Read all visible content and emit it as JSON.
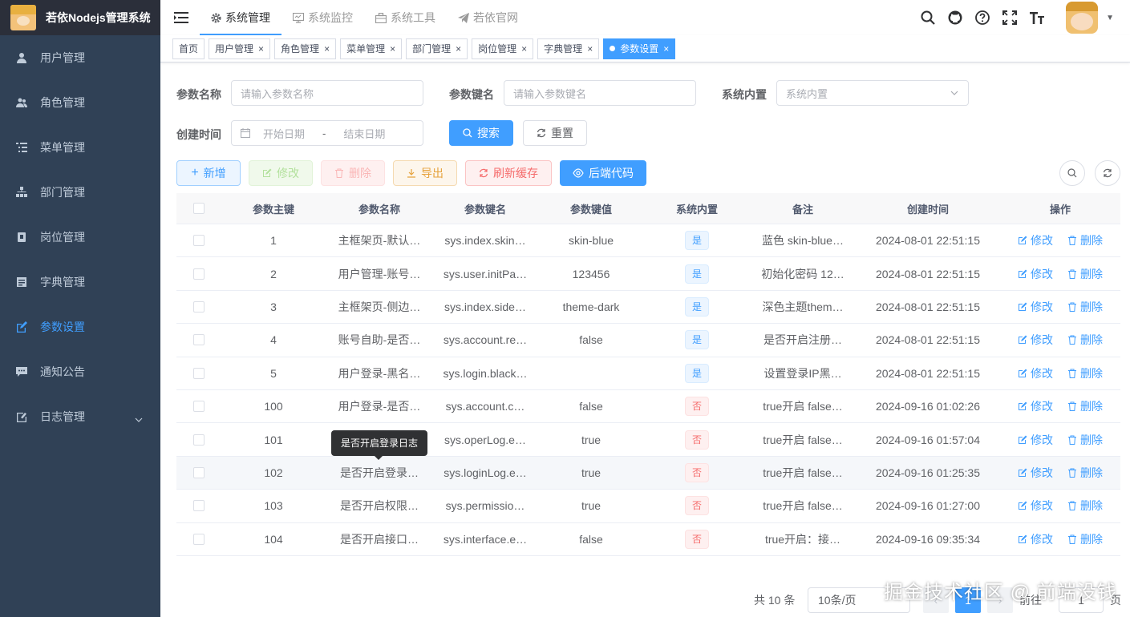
{
  "app": {
    "title": "若依Nodejs管理系统"
  },
  "sidebar": {
    "items": [
      {
        "label": "用户管理"
      },
      {
        "label": "角色管理"
      },
      {
        "label": "菜单管理"
      },
      {
        "label": "部门管理"
      },
      {
        "label": "岗位管理"
      },
      {
        "label": "字典管理"
      },
      {
        "label": "参数设置",
        "active": true
      },
      {
        "label": "通知公告"
      },
      {
        "label": "日志管理"
      }
    ]
  },
  "topnav": {
    "items": [
      {
        "label": "系统管理"
      },
      {
        "label": "系统监控"
      },
      {
        "label": "系统工具"
      },
      {
        "label": "若依官网"
      }
    ]
  },
  "tags": [
    "首页",
    "用户管理",
    "角色管理",
    "菜单管理",
    "部门管理",
    "岗位管理",
    "字典管理",
    "参数设置"
  ],
  "form": {
    "name_label": "参数名称",
    "name_placeholder": "请输入参数名称",
    "key_label": "参数键名",
    "key_placeholder": "请输入参数键名",
    "builtin_label": "系统内置",
    "builtin_placeholder": "系统内置",
    "time_label": "创建时间",
    "start_placeholder": "开始日期",
    "range_sep": "-",
    "end_placeholder": "结束日期",
    "search_label": "搜索",
    "reset_label": "重置"
  },
  "toolbar": {
    "add": "新增",
    "edit": "修改",
    "delete": "删除",
    "export": "导出",
    "refresh_cache": "刷新缓存",
    "backend_code": "后端代码"
  },
  "table": {
    "headers": [
      "参数主键",
      "参数名称",
      "参数键名",
      "参数键值",
      "系统内置",
      "备注",
      "创建时间",
      "操作"
    ],
    "rows": [
      {
        "id": "1",
        "name": "主框架页-默认…",
        "key": "sys.index.skin…",
        "value": "skin-blue",
        "builtin": "是",
        "remark": "蓝色 skin-blue…",
        "time": "2024-08-01 22:51:15"
      },
      {
        "id": "2",
        "name": "用户管理-账号…",
        "key": "sys.user.initPa…",
        "value": "123456",
        "builtin": "是",
        "remark": "初始化密码 12…",
        "time": "2024-08-01 22:51:15"
      },
      {
        "id": "3",
        "name": "主框架页-侧边…",
        "key": "sys.index.side…",
        "value": "theme-dark",
        "builtin": "是",
        "remark": "深色主题them…",
        "time": "2024-08-01 22:51:15"
      },
      {
        "id": "4",
        "name": "账号自助-是否…",
        "key": "sys.account.re…",
        "value": "false",
        "builtin": "是",
        "remark": "是否开启注册…",
        "time": "2024-08-01 22:51:15"
      },
      {
        "id": "5",
        "name": "用户登录-黑名…",
        "key": "sys.login.black…",
        "value": "",
        "builtin": "是",
        "remark": "设置登录IP黑…",
        "time": "2024-08-01 22:51:15"
      },
      {
        "id": "100",
        "name": "用户登录-是否…",
        "key": "sys.account.c…",
        "value": "false",
        "builtin": "否",
        "remark": "true开启 false…",
        "time": "2024-09-16 01:02:26"
      },
      {
        "id": "101",
        "name": "",
        "key": "sys.operLog.e…",
        "value": "true",
        "builtin": "否",
        "remark": "true开启 false…",
        "time": "2024-09-16 01:57:04"
      },
      {
        "id": "102",
        "name": "是否开启登录…",
        "key": "sys.loginLog.e…",
        "value": "true",
        "builtin": "否",
        "remark": "true开启 false…",
        "time": "2024-09-16 01:25:35"
      },
      {
        "id": "103",
        "name": "是否开启权限…",
        "key": "sys.permissio…",
        "value": "true",
        "builtin": "否",
        "remark": "true开启 false…",
        "time": "2024-09-16 01:27:00"
      },
      {
        "id": "104",
        "name": "是否开启接口…",
        "key": "sys.interface.e…",
        "value": "false",
        "builtin": "否",
        "remark": "true开启：接…",
        "time": "2024-09-16 09:35:34"
      }
    ],
    "edit_label": "修改",
    "delete_label": "删除"
  },
  "tooltip": "是否开启登录日志",
  "pagination": {
    "total": "共 10 条",
    "page_size": "10条/页",
    "current": "1",
    "goto_label": "前往",
    "goto_value": "1",
    "page_suffix": "页"
  },
  "watermark": "掘金技术社区 @ 前端没钱",
  "colors": {
    "primary": "#409eff",
    "sidebar": "#304156",
    "danger": "#f56c6c"
  }
}
